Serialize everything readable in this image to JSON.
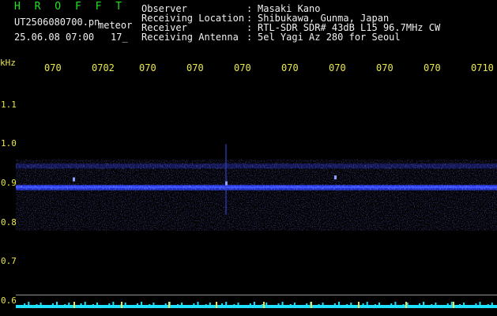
{
  "header": {
    "program": "H R O F F T",
    "filename": "UT2506080700.pn",
    "tag": "meteor",
    "datetime": "25.06.08 07:00",
    "count": "17_"
  },
  "info": [
    {
      "label": "Observer",
      "value": "Masaki Kano"
    },
    {
      "label": "Receiving Location",
      "value": "Shibukawa, Gunma, Japan"
    },
    {
      "label": "Receiver",
      "value": "RTL-SDR SDR# 43dB L15 96.7MHz CW"
    },
    {
      "label": "Receiving Antenna",
      "value": "5el Yagi Az 280 for Seoul"
    }
  ],
  "chart_data": {
    "type": "heatmap",
    "ylabel": "kHz",
    "y_ticks": [
      "1.1",
      "1.0",
      "0.9",
      "0.8",
      "0.7",
      "0.6"
    ],
    "time_ticks": [
      "070",
      "0702",
      "070",
      "070",
      "070",
      "070",
      "070",
      "070",
      "070",
      "0710"
    ],
    "ylim": [
      0.6,
      1.15
    ],
    "carrier_khz": 0.89,
    "colors": {
      "background": "#000000",
      "trace": "#3a4cff",
      "axis": "#e8e84a",
      "noise": "#20e0ff"
    }
  }
}
